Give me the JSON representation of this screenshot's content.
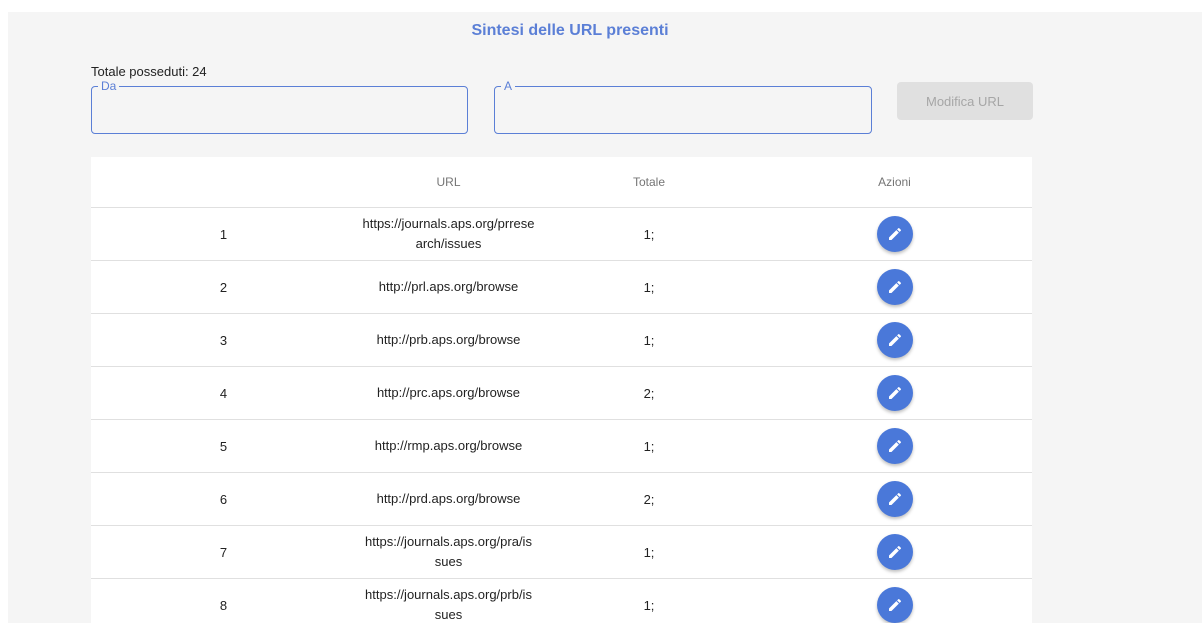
{
  "header": {
    "title": "Sintesi delle URL presenti",
    "total_owned": "Totale posseduti: 24"
  },
  "form": {
    "da_label": "Da",
    "da_value": "",
    "a_label": "A",
    "a_value": "",
    "modify_button": "Modifica URL"
  },
  "table": {
    "columns": [
      "",
      "URL",
      "Totale",
      "Azioni"
    ],
    "rows": [
      {
        "index": "1",
        "url": "https://journals.aps.org/prresearch/issues",
        "total": "1;"
      },
      {
        "index": "2",
        "url": "http://prl.aps.org/browse",
        "total": "1;"
      },
      {
        "index": "3",
        "url": "http://prb.aps.org/browse",
        "total": "1;"
      },
      {
        "index": "4",
        "url": "http://prc.aps.org/browse",
        "total": "2;"
      },
      {
        "index": "5",
        "url": "http://rmp.aps.org/browse",
        "total": "1;"
      },
      {
        "index": "6",
        "url": "http://prd.aps.org/browse",
        "total": "2;"
      },
      {
        "index": "7",
        "url": "https://journals.aps.org/pra/issues",
        "total": "1;"
      },
      {
        "index": "8",
        "url": "https://journals.aps.org/prb/issues",
        "total": "1;"
      }
    ],
    "action_icon": "pencil-icon"
  },
  "colors": {
    "accent": "#5b7fd6",
    "edit_button": "#4a78d9",
    "disabled_button": "#e0e0e0",
    "background": "#f5f5f5"
  }
}
